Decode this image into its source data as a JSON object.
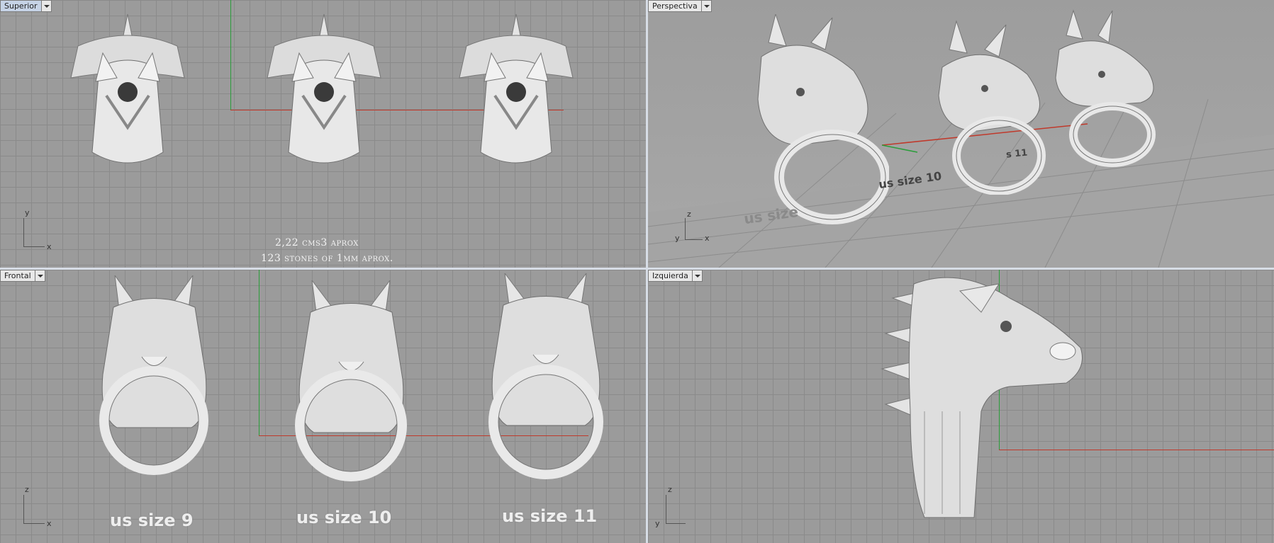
{
  "viewports": {
    "top": {
      "name": "Superior"
    },
    "perspective": {
      "name": "Perspectiva"
    },
    "front": {
      "name": "Frontal"
    },
    "left": {
      "name": "Izquierda"
    }
  },
  "axes": {
    "x": "x",
    "y": "y",
    "z": "z"
  },
  "notes": {
    "volume": "2,22 cms3 aprox",
    "stones": "123 stones of 1mm aprox."
  },
  "sizes": {
    "s9": "us size 9",
    "s10": "us size 10",
    "s11": "us size 11",
    "persp_s9": "us size",
    "persp_s10": "us size 10",
    "persp_s11": "s 11"
  },
  "colors": {
    "x_axis": "#c0392b",
    "y_axis": "#2a9d3a",
    "model": "#e6e6e6"
  },
  "icons": {
    "viewport_menu": "chevron-down-icon"
  }
}
